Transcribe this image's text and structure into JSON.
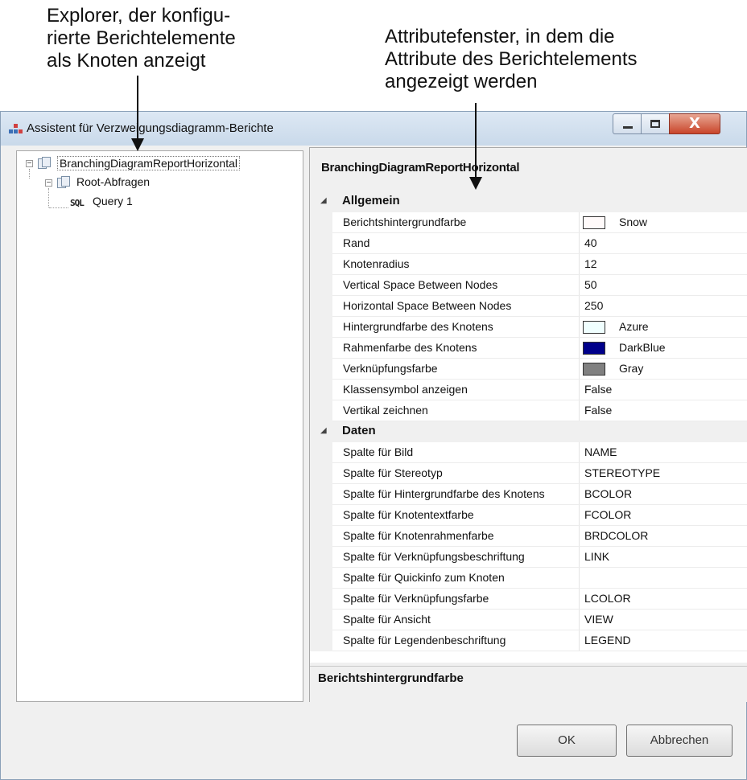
{
  "annotations": {
    "left_callout": "Explorer, der konfigu-\nrierte Berichtelemente\nals Knoten anzeigt",
    "right_callout": "Attributefenster, in dem die\nAttribute des Berichtelements\nangezeigt werden"
  },
  "window": {
    "title": "Assistent für Verzweigungsdiagramm-Berichte",
    "close_glyph": "X"
  },
  "tree": {
    "root": "BranchingDiagramReportHorizontal",
    "child": "Root-Abfragen",
    "grandchild": "Query 1",
    "sql_badge": "SQL"
  },
  "properties": {
    "header": "BranchingDiagramReportHorizontal",
    "categories": [
      {
        "name": "Allgemein",
        "rows": [
          {
            "name": "Berichtshintergrundfarbe",
            "value": "Snow",
            "swatch": "#fffafa"
          },
          {
            "name": "Rand",
            "value": "40"
          },
          {
            "name": "Knotenradius",
            "value": "12"
          },
          {
            "name": "Vertical Space Between Nodes",
            "value": "50"
          },
          {
            "name": "Horizontal Space Between Nodes",
            "value": "250"
          },
          {
            "name": "Hintergrundfarbe des Knotens",
            "value": "Azure",
            "swatch": "#f0ffff"
          },
          {
            "name": "Rahmenfarbe des Knotens",
            "value": "DarkBlue",
            "swatch": "#00008b"
          },
          {
            "name": "Verknüpfungsfarbe",
            "value": "Gray",
            "swatch": "#808080"
          },
          {
            "name": "Klassensymbol anzeigen",
            "value": "False"
          },
          {
            "name": "Vertikal zeichnen",
            "value": "False"
          }
        ]
      },
      {
        "name": "Daten",
        "rows": [
          {
            "name": "Spalte für Bild",
            "value": "NAME"
          },
          {
            "name": "Spalte für Stereotyp",
            "value": "STEREOTYPE"
          },
          {
            "name": "Spalte für Hintergrundfarbe des Knotens",
            "value": "BCOLOR"
          },
          {
            "name": "Spalte für Knotentextfarbe",
            "value": "FCOLOR"
          },
          {
            "name": "Spalte für Knotenrahmenfarbe",
            "value": "BRDCOLOR"
          },
          {
            "name": "Spalte für Verknüpfungsbeschriftung",
            "value": "LINK"
          },
          {
            "name": "Spalte für Quickinfo zum Knoten",
            "value": ""
          },
          {
            "name": "Spalte für Verknüpfungsfarbe",
            "value": "LCOLOR"
          },
          {
            "name": "Spalte für Ansicht",
            "value": "VIEW"
          },
          {
            "name": "Spalte für Legendenbeschriftung",
            "value": "LEGEND"
          }
        ]
      }
    ],
    "description": "Berichtshintergrundfarbe"
  },
  "buttons": {
    "ok": "OK",
    "cancel": "Abbrechen"
  }
}
